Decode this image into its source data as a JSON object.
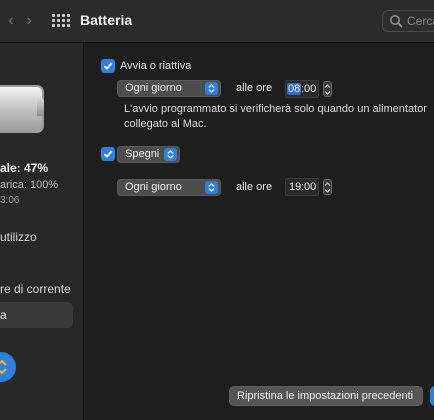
{
  "window": {
    "title": "Batteria"
  },
  "toolbar": {
    "back_icon": "chevron-left-icon",
    "forward_icon": "chevron-right-icon",
    "grid_icon": "grid-icon",
    "search_placeholder": "Cerca"
  },
  "sidebar": {
    "battery_level": "ale: 47%",
    "charge_status": "arica: 100%",
    "time_text": "3:06",
    "items": [
      {
        "label": "utilizzo"
      },
      {
        "label": "re di corrente"
      },
      {
        "label": "a"
      }
    ],
    "selected_index": 2
  },
  "schedule": {
    "start": {
      "checked": true,
      "label": "Avvia o riattiva",
      "frequency": "Ogni giorno",
      "at_label": "alle ore",
      "hour": "08",
      "minute": "00",
      "note": "L'avvio programmato si verificherà solo quando un alimentator collegato al Mac."
    },
    "stop": {
      "checked": true,
      "action": "Spegni",
      "frequency": "Ogni giorno",
      "at_label": "alle ore",
      "hour": "19",
      "minute": "00"
    }
  },
  "footer": {
    "restore_label": "Ripristina le impostazioni precedenti"
  },
  "colors": {
    "accent": "#2f7fdc",
    "background": "#1e1e1e"
  }
}
